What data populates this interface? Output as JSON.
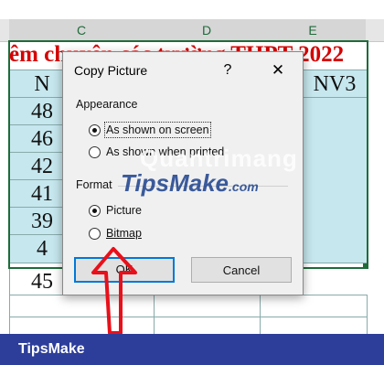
{
  "sheet": {
    "col_headers": [
      "C",
      "D",
      "E"
    ],
    "title_text": "êm chuyên các trường THPT 2022",
    "left_cells": [
      "N",
      "48",
      "46",
      "42",
      "41",
      "39",
      "4",
      "45"
    ],
    "right_cell": "NV3"
  },
  "dialog": {
    "title": "Copy Picture",
    "help": "?",
    "close": "✕",
    "appearance_label": "Appearance",
    "appearance_options": [
      "As shown on screen",
      "As shown when printed"
    ],
    "format_label": "Format",
    "format_options": [
      "Picture",
      "Bitmap"
    ],
    "ok_label": "OK",
    "cancel_label": "Cancel"
  },
  "watermark": {
    "quantrimang": "Quantrimang",
    "tipsmake": "TipsMake",
    "dotcom": ".com"
  },
  "footer": {
    "brand": "TipsMake"
  },
  "colors": {
    "accent_green": "#1f6b3a",
    "title_red": "#d60000",
    "cell_blue": "#c6e7ee",
    "footer_blue": "#2d3e9a",
    "arrow_red": "#e8101a",
    "default_button_border": "#0078d7"
  }
}
